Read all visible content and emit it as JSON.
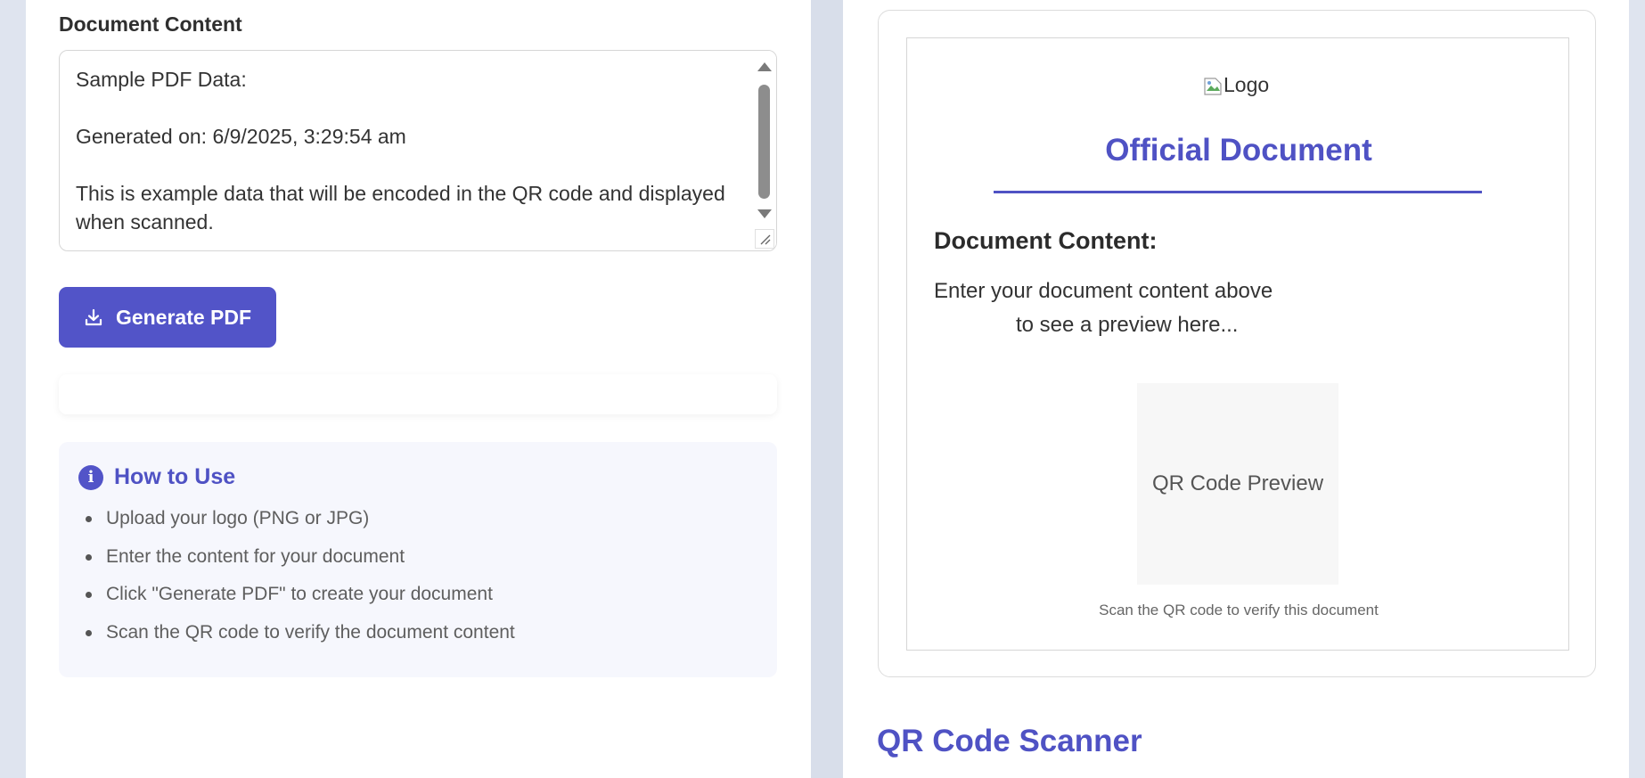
{
  "form": {
    "content_label": "Document Content",
    "content_value": "Sample PDF Data:\n\nGenerated on: 6/9/2025, 3:29:54 am\n\nThis is example data that will be encoded in the QR code and displayed when scanned.",
    "generate_label": "Generate PDF",
    "generate_icon": "download-icon"
  },
  "how_to": {
    "title": "How to Use",
    "icon": "info-icon",
    "steps": [
      "Upload your logo (PNG or JPG)",
      "Enter the content for your document",
      "Click \"Generate PDF\" to create your document",
      "Scan the QR code to verify the document content"
    ]
  },
  "preview": {
    "logo_alt": "Logo",
    "title": "Official Document",
    "content_heading": "Document Content:",
    "placeholder_line1": "Enter your document content above",
    "placeholder_line2": "to see a preview here...",
    "qr_placeholder": "QR Code Preview",
    "qr_caption": "Scan the QR code to verify this document"
  },
  "scanner": {
    "title": "QR Code Scanner"
  },
  "colors": {
    "accent": "#5254c8",
    "accent_text": "#4f52c4",
    "page_background": "#dfe4ef",
    "howto_background": "#f6f7fd"
  }
}
